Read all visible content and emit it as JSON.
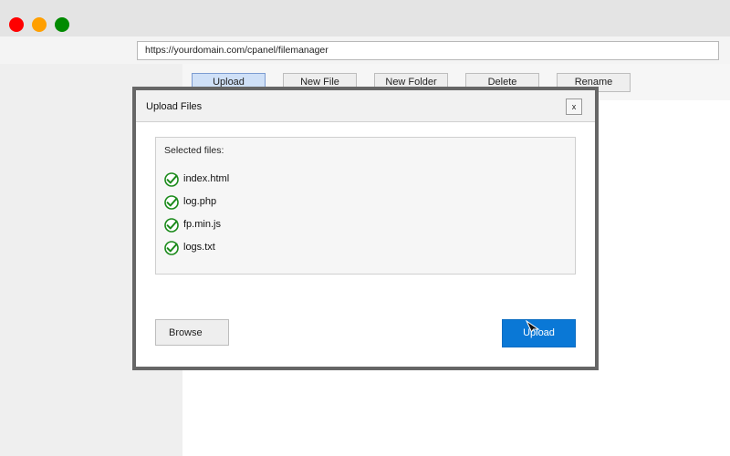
{
  "browser": {
    "url": "https://yourdomain.com/cpanel/filemanager",
    "colors": {
      "close": "#ff0000",
      "minimize": "#ff9f00",
      "maximize": "#008a00"
    }
  },
  "toolbar": {
    "buttons": [
      {
        "label": "Upload",
        "active": true
      },
      {
        "label": "New File",
        "active": false
      },
      {
        "label": "New Folder",
        "active": false
      },
      {
        "label": "Delete",
        "active": false
      },
      {
        "label": "Rename",
        "active": false
      }
    ]
  },
  "dialog": {
    "title": "Upload Files",
    "close_label": "x",
    "selected_heading": "Selected files:",
    "files": [
      {
        "name": "index.html",
        "status_icon": "check-circle-icon"
      },
      {
        "name": "log.php",
        "status_icon": "check-circle-icon"
      },
      {
        "name": "fp.min.js",
        "status_icon": "check-circle-icon"
      },
      {
        "name": "logs.txt",
        "status_icon": "check-circle-icon"
      }
    ],
    "browse_label": "Browse",
    "upload_label": "Upload",
    "accent_color": "#0a78d6"
  }
}
